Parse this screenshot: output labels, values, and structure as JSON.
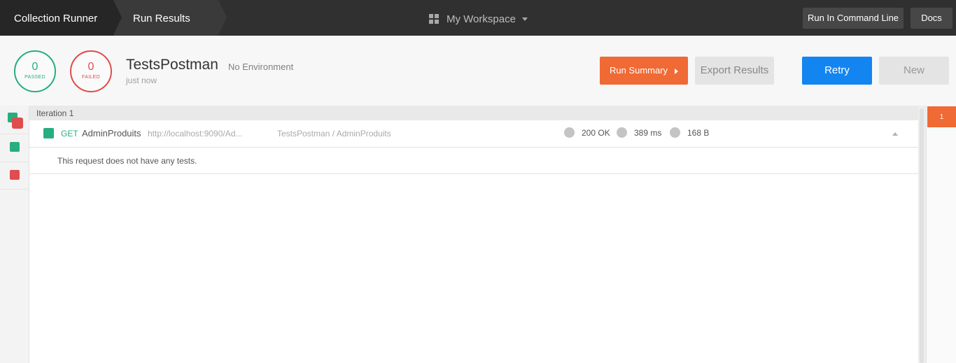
{
  "topbar": {
    "crumb_runner": "Collection Runner",
    "crumb_results": "Run Results",
    "workspace": "My Workspace",
    "run_cli": "Run In Command Line",
    "docs": "Docs"
  },
  "header": {
    "passed_count": "0",
    "passed_label": "PASSED",
    "failed_count": "0",
    "failed_label": "FAILED",
    "collection_name": "TestsPostman",
    "environment": "No Environment",
    "time_ago": "just now",
    "run_summary": "Run Summary",
    "export_results": "Export Results",
    "retry": "Retry",
    "new": "New"
  },
  "iteration": {
    "label": "Iteration 1",
    "marker": "1"
  },
  "request": {
    "method": "GET",
    "name": "AdminProduits",
    "url": "http://localhost:9090/Ad...",
    "path": "TestsPostman / AdminProduits",
    "status": "200 OK",
    "time": "389 ms",
    "size": "168 B",
    "no_tests": "This request does not have any tests."
  },
  "colors": {
    "pass": "#27ae7e",
    "fail": "#e04d4d",
    "accent_orange": "#ef6a34",
    "accent_blue": "#1385f0"
  },
  "icons": [
    "workspace-grid-icon",
    "caret-down-icon",
    "play-triangle-icon",
    "collapse-caret-icon"
  ]
}
